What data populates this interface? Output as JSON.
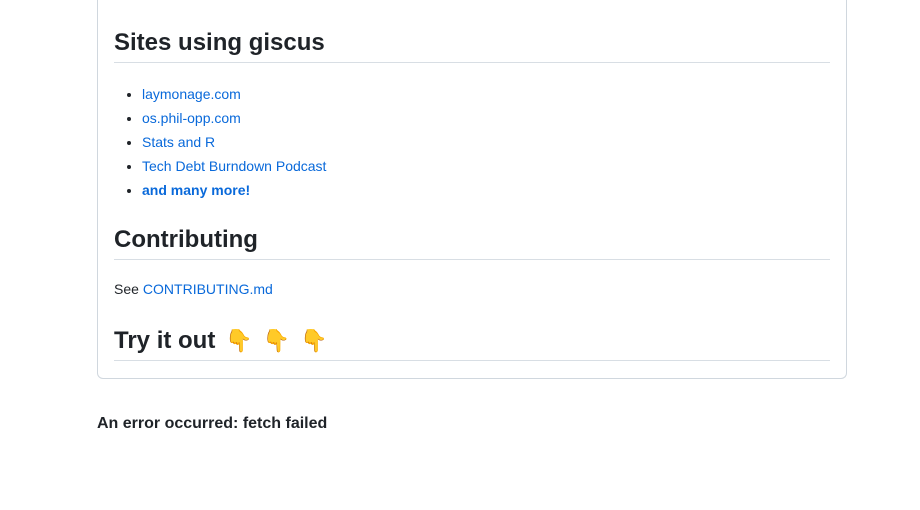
{
  "sections": {
    "sites_heading": "Sites using giscus",
    "sites": [
      {
        "label": "laymonage.com"
      },
      {
        "label": "os.phil-opp.com"
      },
      {
        "label": "Stats and R"
      },
      {
        "label": "Tech Debt Burndown Podcast"
      },
      {
        "label": "and many more!"
      }
    ],
    "contributing_heading": "Contributing",
    "contributing_prefix": "See",
    "contributing_link": "CONTRIBUTING.md",
    "try_heading": "Try it out",
    "try_emojis": [
      "👇",
      "👇",
      "👇"
    ]
  },
  "error": {
    "message": "An error occurred: fetch failed"
  },
  "colors": {
    "link": "#0969da",
    "text": "#1f2328",
    "border": "#d0d7de"
  }
}
